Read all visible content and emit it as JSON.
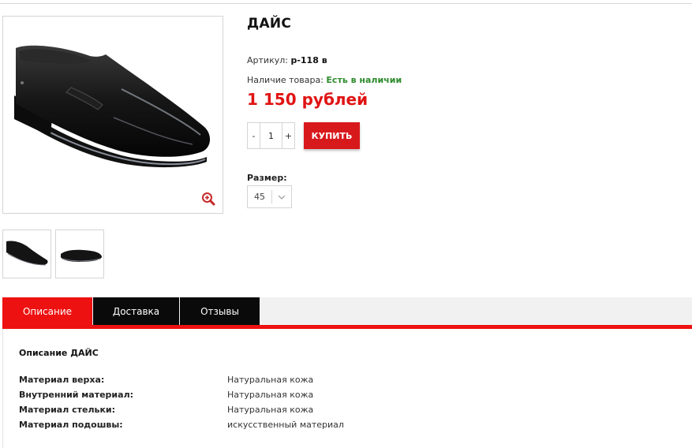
{
  "product": {
    "title": "ДАЙС",
    "sku_label": "Артикул:",
    "sku_value": "р-118 в",
    "stock_label": "Наличие товара:",
    "stock_value": "Есть в наличии",
    "price": "1 150 рублей",
    "quantity": "1",
    "qty_minus": "-",
    "qty_plus": "+",
    "buy_label": "КУПИТЬ",
    "size_label": "Размер:",
    "size_value": "45"
  },
  "gallery": {
    "zoom_icon": "zoom-in-icon",
    "thumbnails": [
      "shoe-side-view",
      "shoe-alt-view"
    ]
  },
  "tabs": [
    {
      "label": "Описание",
      "active": true
    },
    {
      "label": "Доставка",
      "active": false
    },
    {
      "label": "Отзывы",
      "active": false
    }
  ],
  "description": {
    "title": "Описание ДАЙС",
    "specs": [
      {
        "key": "Материал верха:",
        "value": "Натуральная кожа"
      },
      {
        "key": "Внутренний материал:",
        "value": "Натуральная кожа"
      },
      {
        "key": "Материал стельки:",
        "value": "Натуральная кожа"
      },
      {
        "key": "Материал подошвы:",
        "value": "искусственный материал"
      }
    ]
  },
  "colors": {
    "accent": "#ee1111",
    "buy_button": "#d8191c",
    "price": "#e01414",
    "in_stock": "#2e8b2e",
    "tab_dark": "#0a0a0a"
  }
}
